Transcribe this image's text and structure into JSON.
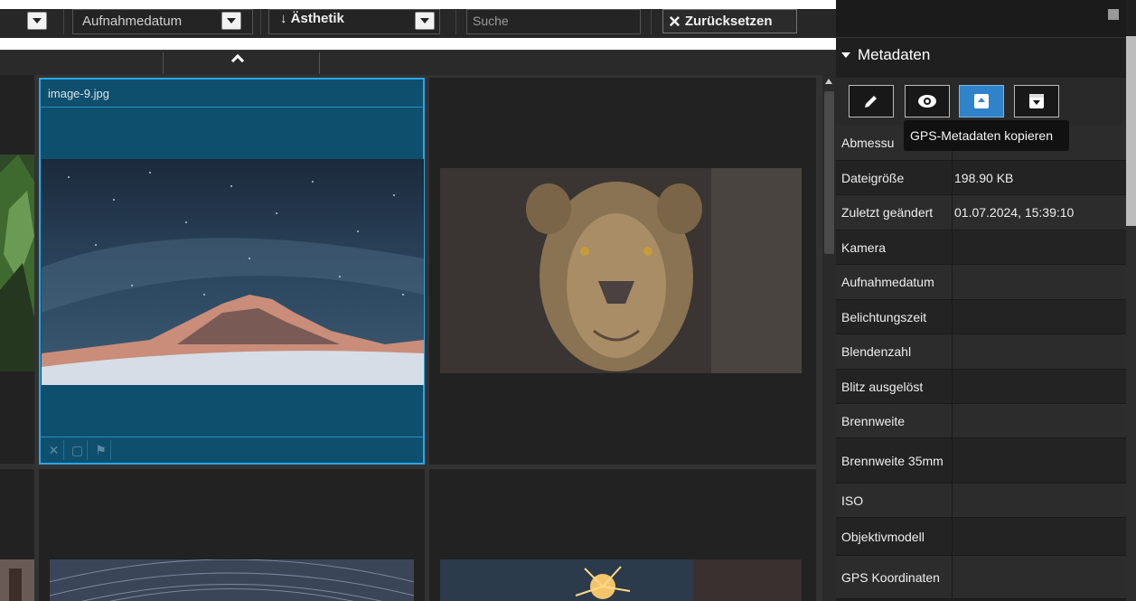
{
  "toolbar": {
    "sort_field": "Aufnahmedatum",
    "sort_label": "Ästhetik",
    "sort_arrow": "↓",
    "search_placeholder": "Suche",
    "reset_label": "Zurücksetzen",
    "reset_icon": "×"
  },
  "grid": {
    "selected_file": "image-9.jpg"
  },
  "panel": {
    "section_title": "Metadaten",
    "tooltip": "GPS-Metadaten kopieren",
    "buttons": [
      {
        "icon": "pencil-icon"
      },
      {
        "icon": "eye-icon"
      },
      {
        "icon": "gps-copy-icon"
      },
      {
        "icon": "gps-paste-icon"
      }
    ],
    "rows": [
      {
        "key": "Abmessu",
        "value": ""
      },
      {
        "key": "Dateigröße",
        "value": "198.90 KB"
      },
      {
        "key": "Zuletzt geändert",
        "value": "01.07.2024, 15:39:10"
      },
      {
        "key": "Kamera",
        "value": ""
      },
      {
        "key": "Aufnahmedatum",
        "value": ""
      },
      {
        "key": "Belichtungszeit",
        "value": ""
      },
      {
        "key": "Blendenzahl",
        "value": ""
      },
      {
        "key": "Blitz ausgelöst",
        "value": ""
      },
      {
        "key": "Brennweite",
        "value": ""
      },
      {
        "key": "Brennweite 35mm",
        "value": ""
      },
      {
        "key": "ISO",
        "value": ""
      },
      {
        "key": "Objektivmodell",
        "value": ""
      },
      {
        "key": "GPS Koordinaten",
        "value": ""
      }
    ]
  },
  "colors": {
    "selection_border": "#2aa7e6",
    "selection_fill": "#0f4f6e",
    "active_button": "#2f83c9"
  }
}
